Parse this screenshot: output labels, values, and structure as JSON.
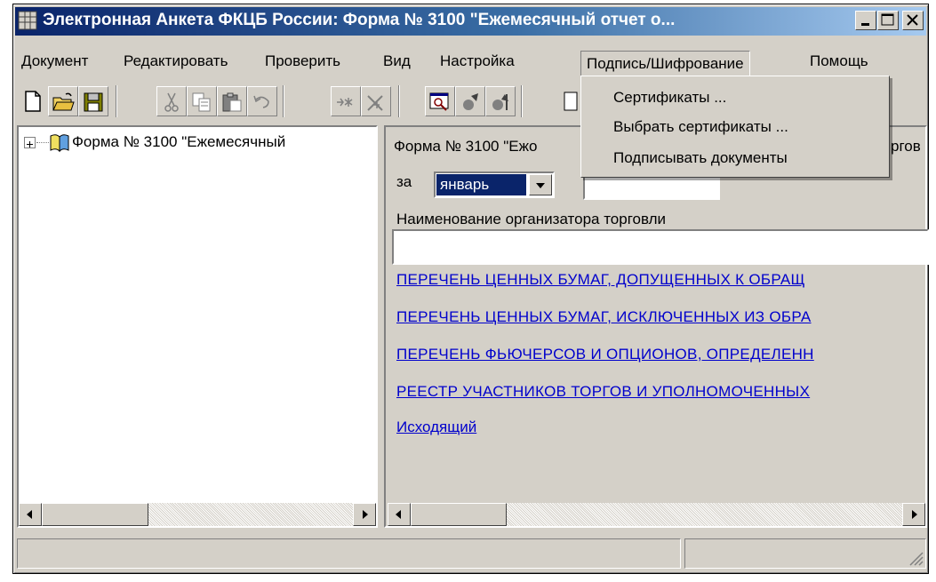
{
  "window": {
    "title": "Электронная Анкета ФКЦБ России: Форма № 3100 \"Ежемесячный отчет о...",
    "colors": {
      "titlebar_start": "#0a246a",
      "titlebar_end": "#a6caf0",
      "face": "#d4d0c8",
      "link": "#0000cc"
    }
  },
  "menu": {
    "items": [
      "Документ",
      "Редактировать",
      "Проверить",
      "Вид",
      "Настройка",
      "Подпись/Шифрование",
      "Помощь"
    ],
    "open_menu": "Подпись/Шифрование",
    "dropdown": [
      "Сертификаты ...",
      "Выбрать сертификаты ...",
      "Подписывать документы"
    ]
  },
  "toolbar": {
    "icons": [
      "new-document-icon",
      "open-folder-icon",
      "save-icon",
      "cut-icon",
      "copy-icon",
      "paste-icon",
      "undo-icon",
      "insert-row-icon",
      "delete-row-icon",
      "find-icon",
      "check-forward-icon",
      "check-back-icon",
      "page-icon"
    ]
  },
  "tree": {
    "root_label": "Форма № 3100 \"Ежемесячный"
  },
  "form": {
    "header": "Форма № 3100 \"Ежо",
    "header_tail": "ргов",
    "period_label": "за",
    "month_value": "январь",
    "year_value": "",
    "org_label": "Наименование организатора торговли",
    "org_value": "",
    "links": [
      "ПЕРЕЧЕНЬ ЦЕННЫХ БУМАГ, ДОПУЩЕННЫХ К ОБРАЩ",
      "ПЕРЕЧЕНЬ ЦЕННЫХ БУМАГ, ИСКЛЮЧЕННЫХ ИЗ ОБРА",
      "ПЕРЕЧЕНЬ ФЬЮЧЕРСОВ И ОПЦИОНОВ, ОПРЕДЕЛЕНН",
      "РЕЕСТР УЧАСТНИКОВ ТОРГОВ И УПОЛНОМОЧЕННЫХ",
      "Исходящий"
    ]
  },
  "status": {
    "text": ""
  }
}
